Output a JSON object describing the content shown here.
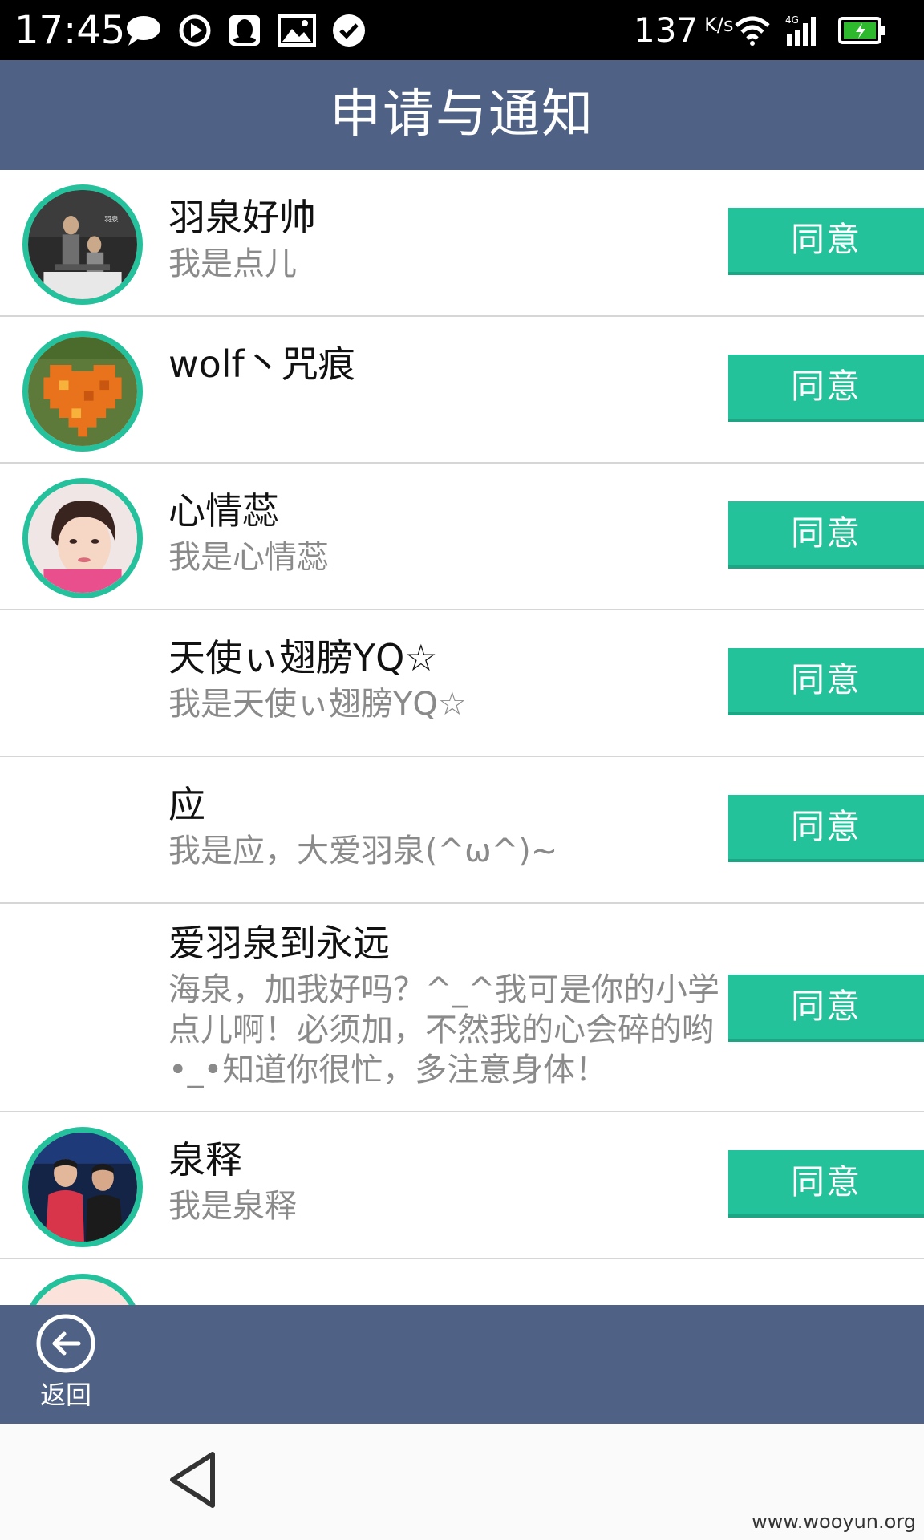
{
  "status_bar": {
    "time": "17:45",
    "speed": "137",
    "speed_unit": "K/s",
    "network": "4G"
  },
  "header": {
    "title": "申请与通知"
  },
  "requests": [
    {
      "name": "羽泉好帅",
      "message": "我是点儿",
      "button": "同意",
      "avatar": "avatar-band-photo"
    },
    {
      "name": "wolf丶咒痕",
      "message": "",
      "button": "同意",
      "avatar": "avatar-pixel-heart"
    },
    {
      "name": "心情蕊",
      "message": "我是心情蕊",
      "button": "同意",
      "avatar": "avatar-girl-selfie"
    },
    {
      "name": "天使ぃ翅膀YQ☆",
      "message": "我是天使ぃ翅膀YQ☆",
      "button": "同意",
      "avatar": ""
    },
    {
      "name": "应",
      "message": "我是应，大爱羽泉(^ω^)~",
      "button": "同意",
      "avatar": ""
    },
    {
      "name": "爱羽泉到永远",
      "message": "海泉，加我好吗？^_^我可是你的小学点儿啊！必须加，不然我的心会碎的哟•_•知道你很忙，多注意身体！",
      "button": "同意",
      "avatar": ""
    },
    {
      "name": "泉释",
      "message": "我是泉释",
      "button": "同意",
      "avatar": "avatar-stage-duo"
    }
  ],
  "footer": {
    "back_label": "返回"
  },
  "watermark": "www.wooyun.org",
  "colors": {
    "header_bg": "#4f6185",
    "accent": "#23c29b",
    "status_bg": "#000000"
  }
}
